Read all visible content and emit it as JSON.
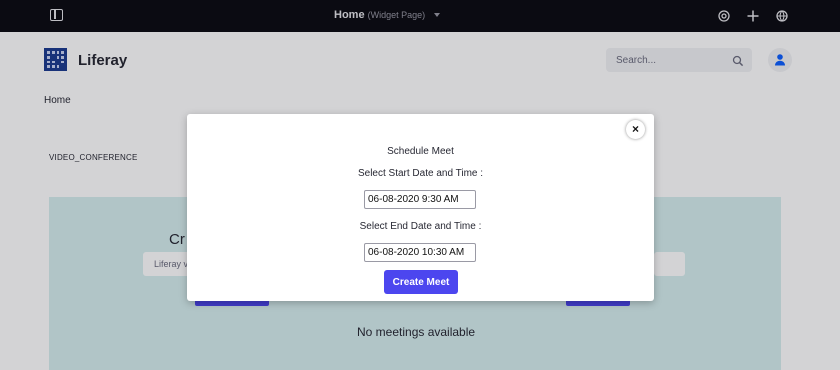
{
  "topbar": {
    "page_title": "Home",
    "page_subtitle": "(Widget Page)",
    "icons": [
      "sidebar-toggle-icon",
      "simulation-icon",
      "add-icon",
      "globe-icon"
    ]
  },
  "header": {
    "site_name": "Liferay",
    "search_placeholder": "Search...",
    "icons": [
      "liferay-logo",
      "search-icon",
      "user-icon"
    ]
  },
  "breadcrumb": {
    "home": "Home"
  },
  "portlet": {
    "section_label": "VIDEO_CONFERENCE",
    "heading_fragment": "Cr",
    "input_fragment": "Liferay v",
    "empty_message": "No meetings available"
  },
  "modal": {
    "title": "Schedule Meet",
    "start_label": "Select Start Date and Time :",
    "start_value": "06-08-2020 9:30 AM",
    "end_label": "Select End Date and Time :",
    "end_value": "06-08-2020 10:30 AM",
    "create_label": "Create Meet",
    "close_glyph": "×"
  },
  "colors": {
    "topbar": "#0b0b12",
    "accent": "#4c46ef",
    "card_bg": "#d6eeee",
    "logo": "#1c3b8f"
  }
}
